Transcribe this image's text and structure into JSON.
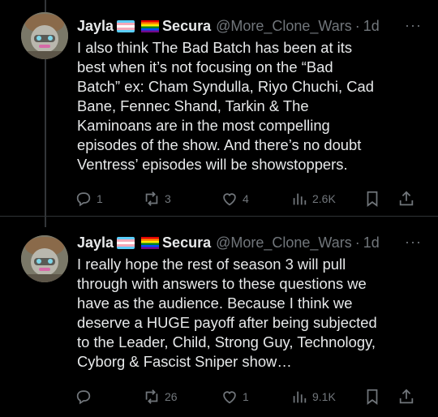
{
  "tweets": [
    {
      "display_name": "Jayla",
      "display_name_suffix": "Secura",
      "handle": "@More_Clone_Wars",
      "separator": "·",
      "time": "1d",
      "more": "···",
      "text": "I also think The Bad Batch has been at its\nbest when it’s not focusing on the “Bad\nBatch” ex: Cham Syndulla, Riyo Chuchi, Cad\nBane, Fennec Shand, Tarkin & The\nKaminoans are in the most compelling\nepisodes of the show. And there’s no doubt\nVentress’ episodes will be showstoppers.",
      "actions": {
        "replies": "1",
        "reposts": "3",
        "likes": "4",
        "views": "2.6K"
      }
    },
    {
      "display_name": "Jayla",
      "display_name_suffix": "Secura",
      "handle": "@More_Clone_Wars",
      "separator": "·",
      "time": "1d",
      "more": "···",
      "text": "I really hope the rest of season 3 will pull\nthrough with answers to these questions we\nhave as the audience. Because I think we\ndeserve a HUGE payoff after being subjected\nto the Leader, Child, Strong Guy, Technology,\nCyborg & Fascist Sniper show…",
      "actions": {
        "replies": "",
        "reposts": "26",
        "likes": "1",
        "views": "9.1K"
      }
    }
  ],
  "icons": {
    "reply": "reply-icon",
    "repost": "repost-icon",
    "like": "heart-icon",
    "views": "views-chart-icon",
    "bookmark": "bookmark-icon",
    "share": "share-icon",
    "trans_flag": "trans-flag-icon",
    "rainbow_flag": "rainbow-flag-icon"
  },
  "colors": {
    "background": "#000000",
    "text": "#e7e9ea",
    "muted": "#71767b",
    "divider": "#2f3336"
  }
}
